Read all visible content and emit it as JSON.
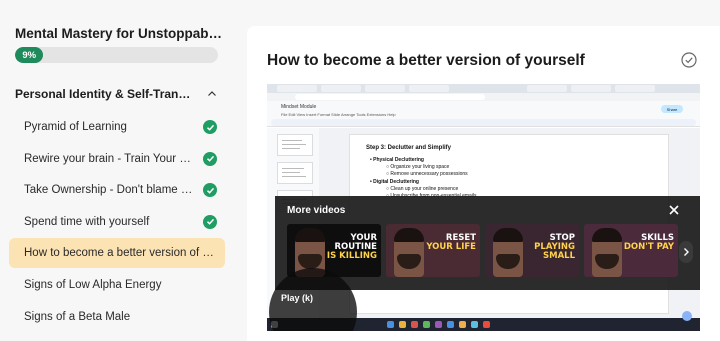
{
  "course": {
    "title": "Mental Mastery for Unstoppable Growth",
    "progress_label": "9%",
    "progress_fraction": 0.09
  },
  "section": {
    "title": "Personal Identity & Self-Transformation",
    "lessons": [
      {
        "label": "Pyramid of Learning",
        "completed": true,
        "active": false
      },
      {
        "label": "Rewire your brain - Train Your Subconscious",
        "completed": true,
        "active": false
      },
      {
        "label": "Take Ownership - Don't blame others",
        "completed": true,
        "active": false
      },
      {
        "label": "Spend time with yourself",
        "completed": true,
        "active": false
      },
      {
        "label": "How to become a better version of yourself",
        "completed": false,
        "active": true
      },
      {
        "label": "Signs of Low Alpha Energy",
        "completed": false,
        "active": false
      },
      {
        "label": "Signs of a Beta Male",
        "completed": false,
        "active": false
      }
    ]
  },
  "lesson": {
    "title": "How to become a better version of yourself"
  },
  "video": {
    "doc_name": "Mindset Module",
    "doc_menu": "File  Edit  View  Insert  Format  Slide  Arrange  Tools  Extensions  Help",
    "share_label": "Share",
    "slide_lines": [
      {
        "text": "Step 3: Declutter and Simplify",
        "style": "h"
      },
      {
        "text": "•   Physical Decluttering",
        "style": "bold"
      },
      {
        "text": "○   Organize your living space",
        "style": ""
      },
      {
        "text": "○   Remove unnecessary possessions",
        "style": ""
      },
      {
        "text": "•   Digital Decluttering",
        "style": "bold"
      },
      {
        "text": "○   Clean up your online presence",
        "style": ""
      },
      {
        "text": "○   Unsubscribe from non-essential emails",
        "style": ""
      }
    ],
    "more_videos_title": "More videos",
    "play_label": "Play (k)",
    "cards": [
      {
        "line1": "YOUR ROUTINE",
        "line2": "IS KILLING",
        "bg": "#0e0e0e"
      },
      {
        "line1": "RESET",
        "line2": "YOUR LIFE",
        "bg": "#4a2a33"
      },
      {
        "line1": "STOP",
        "line2": "PLAYING SMALL",
        "bg": "#3a2630"
      },
      {
        "line1": "SKILLS",
        "line2": "DON'T PAY",
        "bg": "#4b2b3b"
      }
    ]
  },
  "colors": {
    "accent_green": "#1f8a5b",
    "active_lesson_bg": "#fbe3b4",
    "check_green": "#1f9d62"
  }
}
